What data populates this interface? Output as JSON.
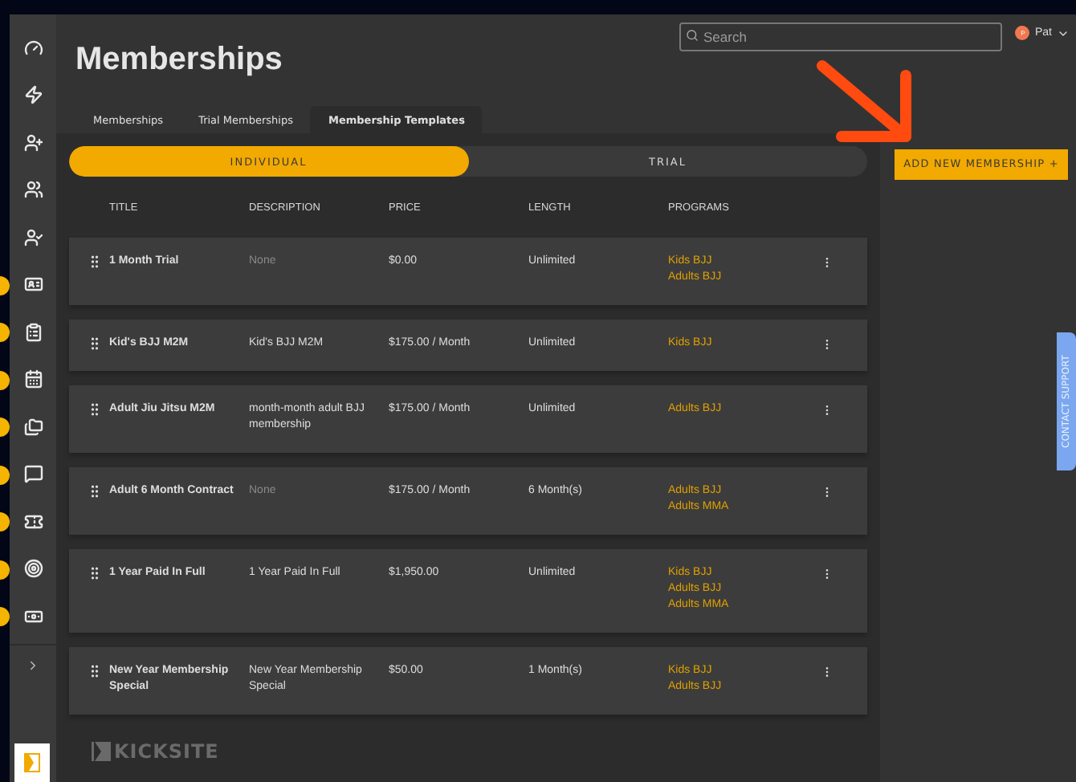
{
  "sidebar": {
    "items": [
      {
        "kind": "gauge",
        "alert": false
      },
      {
        "kind": "bolt",
        "alert": false
      },
      {
        "kind": "user-plus",
        "alert": false
      },
      {
        "kind": "users",
        "alert": false
      },
      {
        "kind": "user-check",
        "alert": false
      },
      {
        "kind": "id-card",
        "alert": true
      },
      {
        "kind": "clipboard",
        "alert": true
      },
      {
        "kind": "calendar",
        "alert": true
      },
      {
        "kind": "folders",
        "alert": true
      },
      {
        "kind": "chat",
        "alert": true
      },
      {
        "kind": "ticket",
        "alert": true
      },
      {
        "kind": "target",
        "alert": true
      },
      {
        "kind": "cash",
        "alert": true
      }
    ]
  },
  "search": {
    "placeholder": "Search"
  },
  "user": {
    "initial": "P",
    "name": "Pat"
  },
  "page_title": "Memberships",
  "tabs": [
    {
      "label": "Memberships",
      "selected": false
    },
    {
      "label": "Trial Memberships",
      "selected": false
    },
    {
      "label": "Membership Templates",
      "selected": true
    }
  ],
  "segments": [
    {
      "label": "INDIVIDUAL",
      "selected": true
    },
    {
      "label": "TRIAL",
      "selected": false
    }
  ],
  "add_button": "ADD NEW MEMBERSHIP +",
  "table": {
    "columns": [
      "TITLE",
      "DESCRIPTION",
      "PRICE",
      "LENGTH",
      "PROGRAMS"
    ],
    "rows": [
      {
        "title": "1 Month Trial",
        "description": "None",
        "description_empty": true,
        "price": "$0.00",
        "length": "Unlimited",
        "programs": [
          "Kids BJJ",
          "Adults BJJ"
        ]
      },
      {
        "title": "Kid's BJJ M2M",
        "description": "Kid's BJJ M2M",
        "description_empty": false,
        "price": "$175.00 / Month",
        "length": "Unlimited",
        "programs": [
          "Kids BJJ"
        ]
      },
      {
        "title": "Adult Jiu Jitsu M2M",
        "description": "month-month adult BJJ membership",
        "description_empty": false,
        "price": "$175.00 / Month",
        "length": "Unlimited",
        "programs": [
          "Adults BJJ"
        ]
      },
      {
        "title": "Adult 6 Month Contract",
        "description": "None",
        "description_empty": true,
        "price": "$175.00 / Month",
        "length": "6 Month(s)",
        "programs": [
          "Adults BJJ",
          "Adults MMA"
        ]
      },
      {
        "title": "1 Year Paid In Full",
        "description": "1 Year Paid In Full",
        "description_empty": false,
        "price": "$1,950.00",
        "length": "Unlimited",
        "programs": [
          "Kids BJJ",
          "Adults BJJ",
          "Adults MMA"
        ]
      },
      {
        "title": "New Year Membership Special",
        "description": "New Year Membership Special",
        "description_empty": false,
        "price": "$50.00",
        "length": "1 Month(s)",
        "programs": [
          "Kids BJJ",
          "Adults BJJ"
        ]
      }
    ]
  },
  "footer_brand": "KICKSITE",
  "contact_support": "CONTACT SUPPORT"
}
